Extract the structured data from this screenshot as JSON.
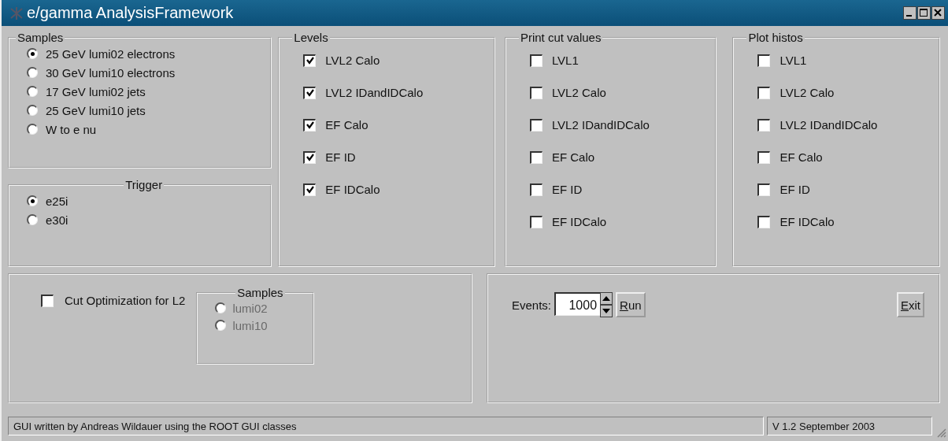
{
  "window": {
    "title": "e/gamma AnalysisFramework"
  },
  "samples": {
    "title": "Samples",
    "options": [
      {
        "label": "25 GeV lumi02 electrons",
        "selected": true
      },
      {
        "label": "30 GeV lumi10 electrons",
        "selected": false
      },
      {
        "label": "17 GeV lumi02 jets",
        "selected": false
      },
      {
        "label": "25 GeV lumi10 jets",
        "selected": false
      },
      {
        "label": "W to e nu",
        "selected": false
      }
    ]
  },
  "trigger": {
    "title": "Trigger",
    "options": [
      {
        "label": "e25i",
        "selected": true
      },
      {
        "label": "e30i",
        "selected": false
      }
    ]
  },
  "levels": {
    "title": "Levels",
    "items": [
      {
        "label": "LVL2 Calo",
        "checked": true
      },
      {
        "label": "LVL2 IDandIDCalo",
        "checked": true
      },
      {
        "label": "EF Calo",
        "checked": true
      },
      {
        "label": "EF ID",
        "checked": true
      },
      {
        "label": "EF IDCalo",
        "checked": true
      }
    ]
  },
  "print_cut_values": {
    "title": "Print cut values",
    "items": [
      {
        "label": "LVL1",
        "checked": false
      },
      {
        "label": "LVL2 Calo",
        "checked": false
      },
      {
        "label": "LVL2 IDandIDCalo",
        "checked": false
      },
      {
        "label": "EF Calo",
        "checked": false
      },
      {
        "label": "EF ID",
        "checked": false
      },
      {
        "label": "EF IDCalo",
        "checked": false
      }
    ]
  },
  "plot_histos": {
    "title": "Plot histos",
    "items": [
      {
        "label": "LVL1",
        "checked": false
      },
      {
        "label": "LVL2 Calo",
        "checked": false
      },
      {
        "label": "LVL2 IDandIDCalo",
        "checked": false
      },
      {
        "label": "EF Calo",
        "checked": false
      },
      {
        "label": "EF ID",
        "checked": false
      },
      {
        "label": "EF IDCalo",
        "checked": false
      }
    ]
  },
  "cut_optimization": {
    "label": "Cut Optimization for L2",
    "checked": false,
    "samples": {
      "title": "Samples",
      "disabled": true,
      "options": [
        {
          "label": "lumi02",
          "selected": false
        },
        {
          "label": "lumi10",
          "selected": false
        }
      ]
    }
  },
  "events": {
    "label": "Events:",
    "value": "1000"
  },
  "run_button": {
    "label": "Run"
  },
  "exit_button": {
    "label": "Exit"
  },
  "status_bar": [
    "GUI written by Andreas Wildauer using the ROOT GUI classes",
    "V 1.2 September 2003"
  ]
}
